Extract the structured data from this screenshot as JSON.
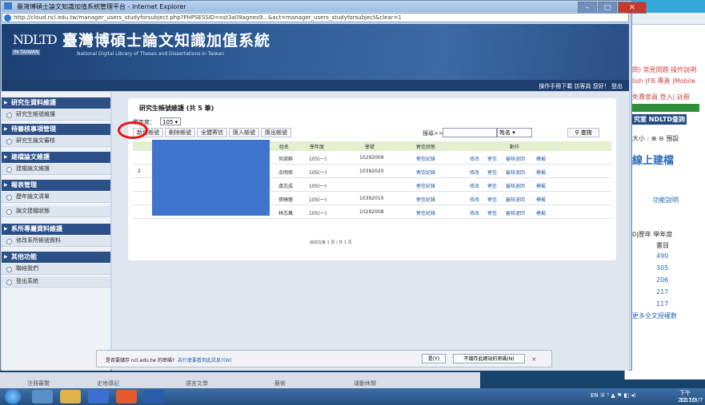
{
  "window": {
    "title": "臺灣博碩士論文知識加值系統管理平台 - Internet Explorer",
    "address": "http://cloud.ncl.edu.tw/manager_users_studyforsubject.php?PHPSESSID=nst3a09agnes9...&act=manager_users_studyforsubject&clear=1"
  },
  "banner": {
    "logo_main": "NDLTD",
    "logo_sub": "IN TAIWAN",
    "title": "臺灣博碩士論文知識加值系統",
    "subtitle": "National Digital Library of Theses and Dissertations in Taiwan"
  },
  "topnav": {
    "text": "操作手冊下載   訪客員   您好！   登出"
  },
  "sidebar": {
    "sections": [
      {
        "label": "研究生資料維護",
        "items": [
          "研究生帳號維護"
        ]
      },
      {
        "label": "待審核事項管理",
        "items": [
          "研究生論文審核"
        ]
      },
      {
        "label": "建檔論文維護",
        "items": [
          "建檔論文維護"
        ]
      },
      {
        "label": "報表管理",
        "items": [
          "歷年論文清單",
          "論文建檔狀態"
        ]
      },
      {
        "label": "系所專屬資料維護",
        "items": [
          "修改系所帳號資料"
        ]
      },
      {
        "label": "其他功能",
        "items": [
          "聯絡我們",
          "登出系統"
        ]
      }
    ]
  },
  "main": {
    "panel_title": "研究生帳號維護 (共 5 筆)",
    "year_label": "學年度：",
    "year_value": "105",
    "toolbar": [
      "新增帳號",
      "刪除帳號",
      "全體寄信",
      "匯入帳號",
      "匯出帳號"
    ],
    "search_label": "搜尋>>",
    "search_field": "姓名",
    "search_button": "查詢",
    "columns": [
      "姓名",
      "學年度",
      "學號",
      "寄信狀態",
      "動作"
    ],
    "rows": [
      {
        "name": "何淑群",
        "year": "105(一)",
        "id": "10292009",
        "status": "寄信紀錄"
      },
      {
        "name": "余明修",
        "year": "105(一)",
        "id": "10392020",
        "status": "寄信紀錄"
      },
      {
        "name": "虞志成",
        "year": "105(一)",
        "id": "",
        "status": "寄信紀錄"
      },
      {
        "name": "張曉蓉",
        "year": "105(一)",
        "id": "10392010",
        "status": "寄信紀錄"
      },
      {
        "name": "林志萬",
        "year": "105(一)",
        "id": "10292008",
        "status": "寄信紀錄"
      }
    ],
    "row_actions": [
      "修改",
      "寄信",
      "審核退回",
      "模擬"
    ],
    "row_index_visible": "2",
    "pagination": "目前在第 1 頁 / 共 1 頁"
  },
  "password_prompt": {
    "question": "是否要儲存 ncl.edu.tw 的密碼?",
    "link": "為什麼要看到此訊息?(W)",
    "yes": "是(Y)",
    "no": "不儲存此網站的密碼(N)",
    "close": "×"
  },
  "footer": {
    "links": [
      "注冊審覽",
      "史地導記",
      "語言文學",
      "藝術",
      "運動休閒"
    ]
  },
  "background_window": {
    "lines": [
      "問) 常見問題  操作說明",
      "lish  |FB 專頁 |Mobile",
      "免費會員 登入| 註冊",
      "究室  NDLTD查詢",
      "大小 :  ⊕  ⊖  預設",
      "線上建檔",
      "功能說明",
      "0|歷年 學年度",
      "書目",
      "490",
      "305",
      "206",
      "217",
      "117",
      "更多全文授權數"
    ]
  },
  "taskbar": {
    "tray": "EN ② ⁵  ▲  ⚑  ◧  ◂)",
    "time": "下午 12:10",
    "date": "2017/3/7"
  },
  "colors": {
    "accent": "#2b4f86",
    "highlight": "#e11111",
    "header_bg": "#e3efcf",
    "redaction": "#3e74cc"
  }
}
